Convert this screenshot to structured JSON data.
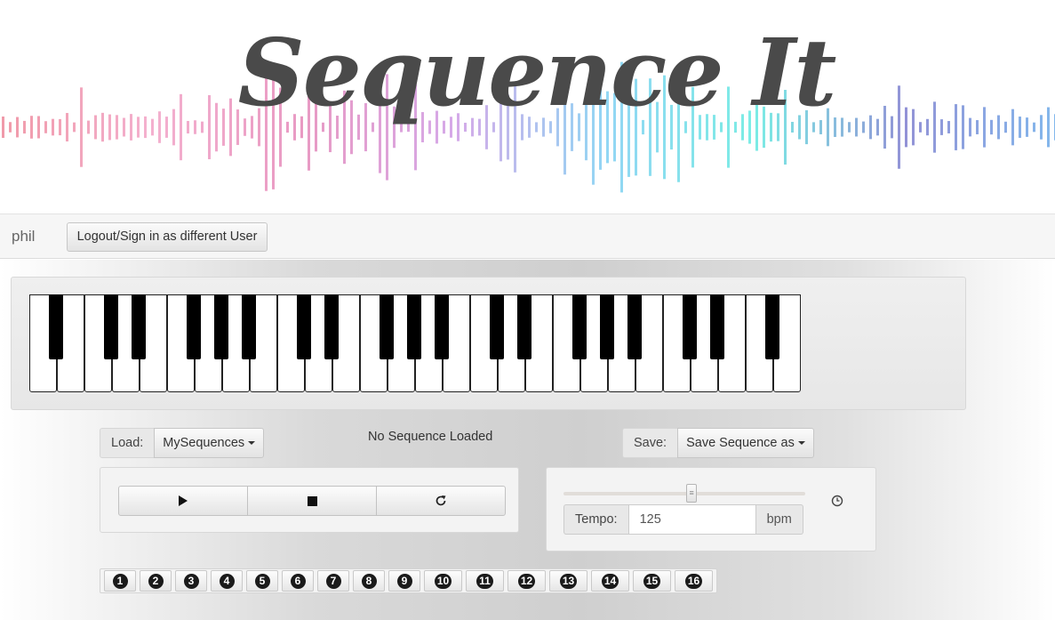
{
  "banner": {
    "title": "Sequence It"
  },
  "user": {
    "name": "phil",
    "logout_label": "Logout/Sign in as different User"
  },
  "load": {
    "label": "Load:",
    "dropdown_label": "MySequences"
  },
  "status": {
    "text": "No Sequence Loaded"
  },
  "save": {
    "label": "Save:",
    "dropdown_label": "Save Sequence as"
  },
  "transport": {
    "buttons": [
      "play-icon",
      "stop-icon",
      "refresh-icon"
    ]
  },
  "tempo": {
    "label": "Tempo:",
    "value": "125",
    "unit": "bpm",
    "slider_fraction": 0.53
  },
  "steps": [
    "1",
    "2",
    "3",
    "4",
    "5",
    "6",
    "7",
    "8",
    "9",
    "10",
    "11",
    "12",
    "13",
    "14",
    "15",
    "16"
  ],
  "keyboard": {
    "white_keys": 28,
    "black_after_white": [
      0,
      2,
      3,
      5,
      6,
      7,
      9,
      10,
      12,
      13,
      14,
      16,
      17,
      19,
      20,
      21,
      23,
      24,
      26
    ]
  }
}
